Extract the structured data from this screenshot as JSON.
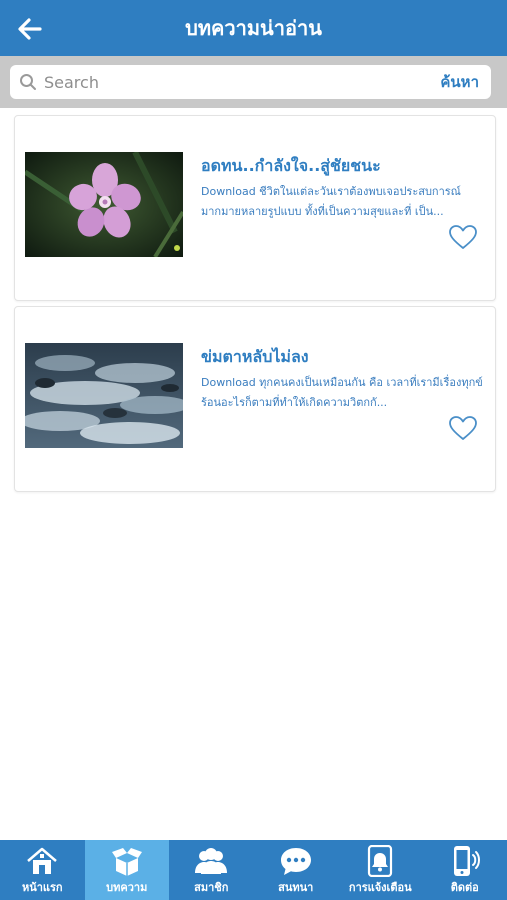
{
  "header": {
    "title": "บทความน่าอ่าน",
    "back_icon": "arrow-left-icon"
  },
  "search": {
    "placeholder": "Search",
    "value": "",
    "button_label": "ค้นหา",
    "icon": "search-icon"
  },
  "articles": [
    {
      "title": "อดทน..กำลังใจ..สู่ชัยชนะ",
      "excerpt": "Download ชีวิตในแต่ละวันเราต้องพบเจอประสบการณ์มากมายหลายรูปแบบ ทั้งที่เป็นความสุขและที่ เป็น...",
      "image": "pink-flower-photo",
      "favorite_icon": "heart-outline-icon"
    },
    {
      "title": "ข่มตาหลับไม่ลง",
      "excerpt": "Download ทุกคนคงเป็นเหมือนกัน คือ เวลาที่เรามีเรื่องทุกข์ร้อนอะไรก็ตามที่ทำให้เกิดความวิตกกั...",
      "image": "flowing-water-photo",
      "favorite_icon": "heart-outline-icon"
    }
  ],
  "bottom_nav": [
    {
      "label": "หน้าแรก",
      "icon": "home-icon",
      "active": false
    },
    {
      "label": "บทความ",
      "icon": "open-box-icon",
      "active": true
    },
    {
      "label": "สมาชิก",
      "icon": "members-icon",
      "active": false
    },
    {
      "label": "สนทนา",
      "icon": "chat-bubble-icon",
      "active": false
    },
    {
      "label": "การแจ้งเตือน",
      "icon": "notification-bell-icon",
      "active": false
    },
    {
      "label": "ติดต่อ",
      "icon": "phone-contact-icon",
      "active": false
    }
  ],
  "colors": {
    "primary": "#2f7ec1",
    "active_tab": "#5bb0e6",
    "search_bar_bg": "#c8c8c8"
  }
}
